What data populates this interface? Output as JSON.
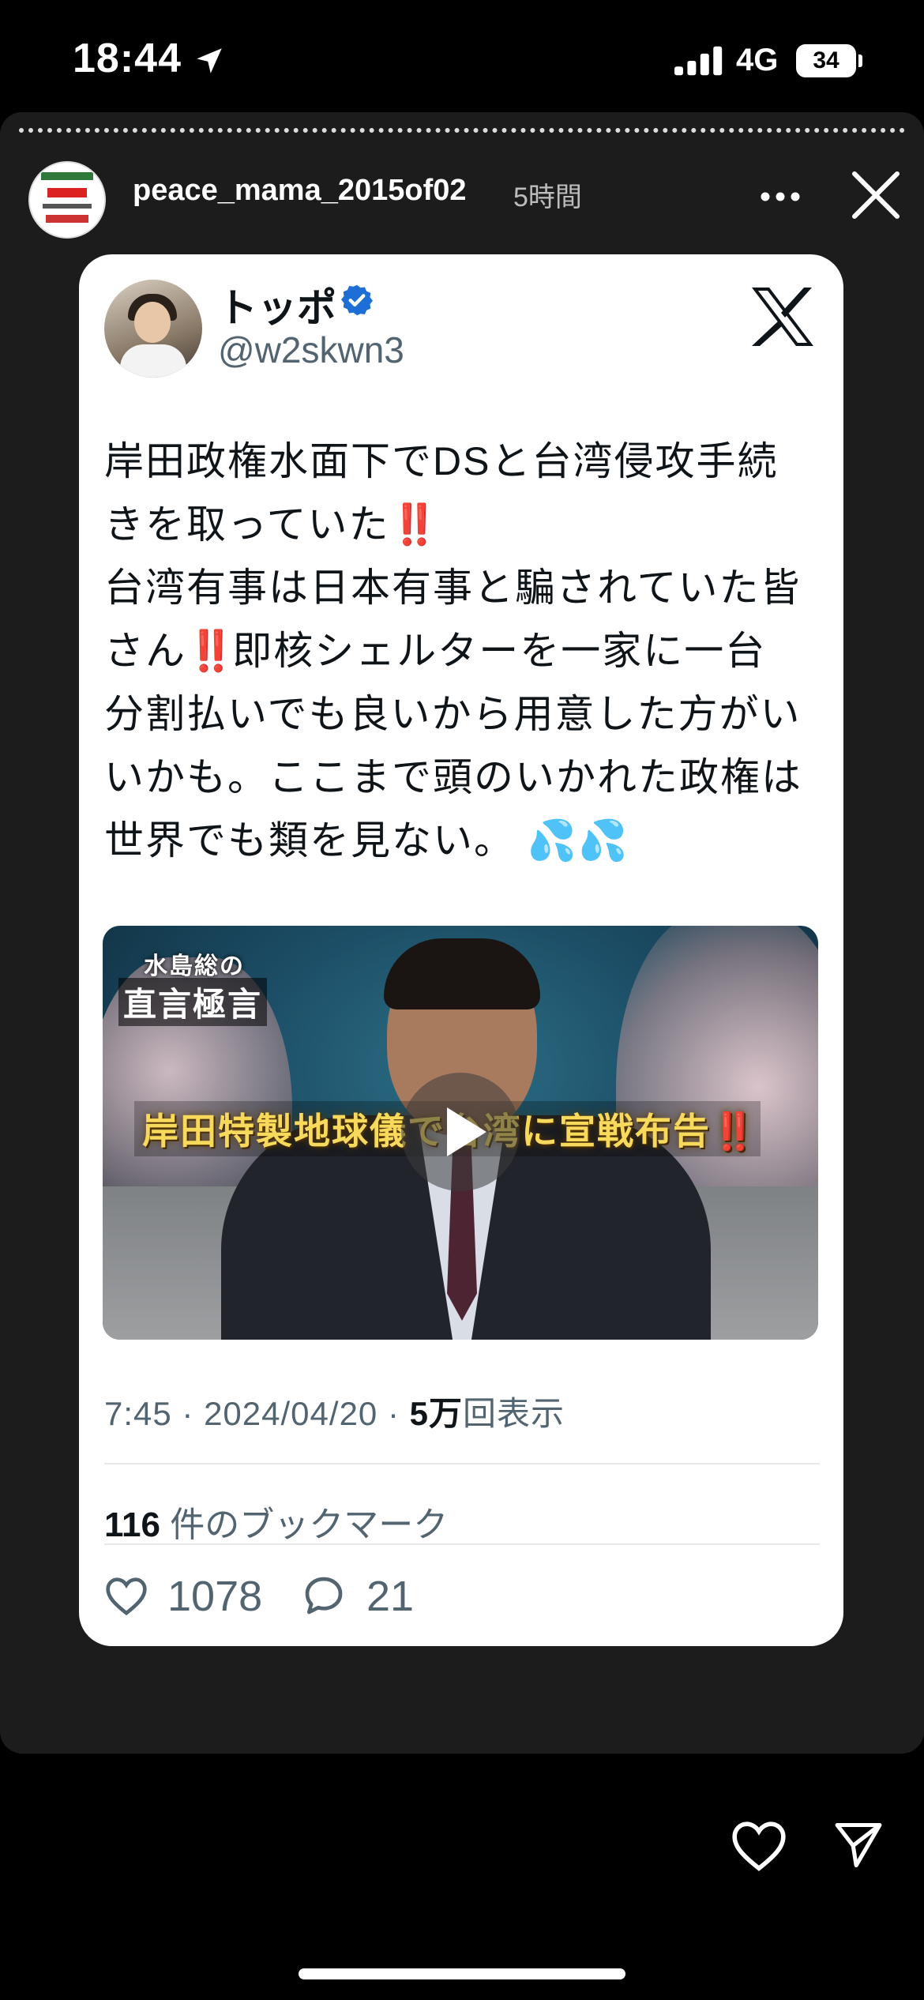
{
  "status_bar": {
    "time": "18:44",
    "network": "4G",
    "battery": "34"
  },
  "story": {
    "username": "peace_mama_2015of02",
    "time_ago": "5時間"
  },
  "tweet": {
    "display_name": "トッポ",
    "handle": "@w2skwn3",
    "text_lines": [
      "岸田政権水面下でDSと台湾侵攻手続",
      "きを取っていた",
      "台湾有事は日本有事と騙されていた皆",
      "さん",
      "即核シェルターを一家に一台",
      "分割払いでも良いから用意した方がい",
      "いかも。ここまで頭のいかれた政権は",
      "世界でも類を見ない。"
    ],
    "emphasis": "‼️",
    "sweat_drops": "💦💦",
    "media": {
      "brand_line1": "水島総の",
      "brand_line2": "直言極言",
      "caption": "岸田特製地球儀で台湾に宣戦布告",
      "caption_emphasis": "‼️"
    },
    "meta": {
      "time": "7:45",
      "separator": " · ",
      "date": "2024/04/20",
      "views_count": "5万",
      "views_label": "回表示"
    },
    "bookmarks_count": "116",
    "bookmarks_label": " 件のブックマーク",
    "likes": "1078",
    "replies": "21"
  }
}
